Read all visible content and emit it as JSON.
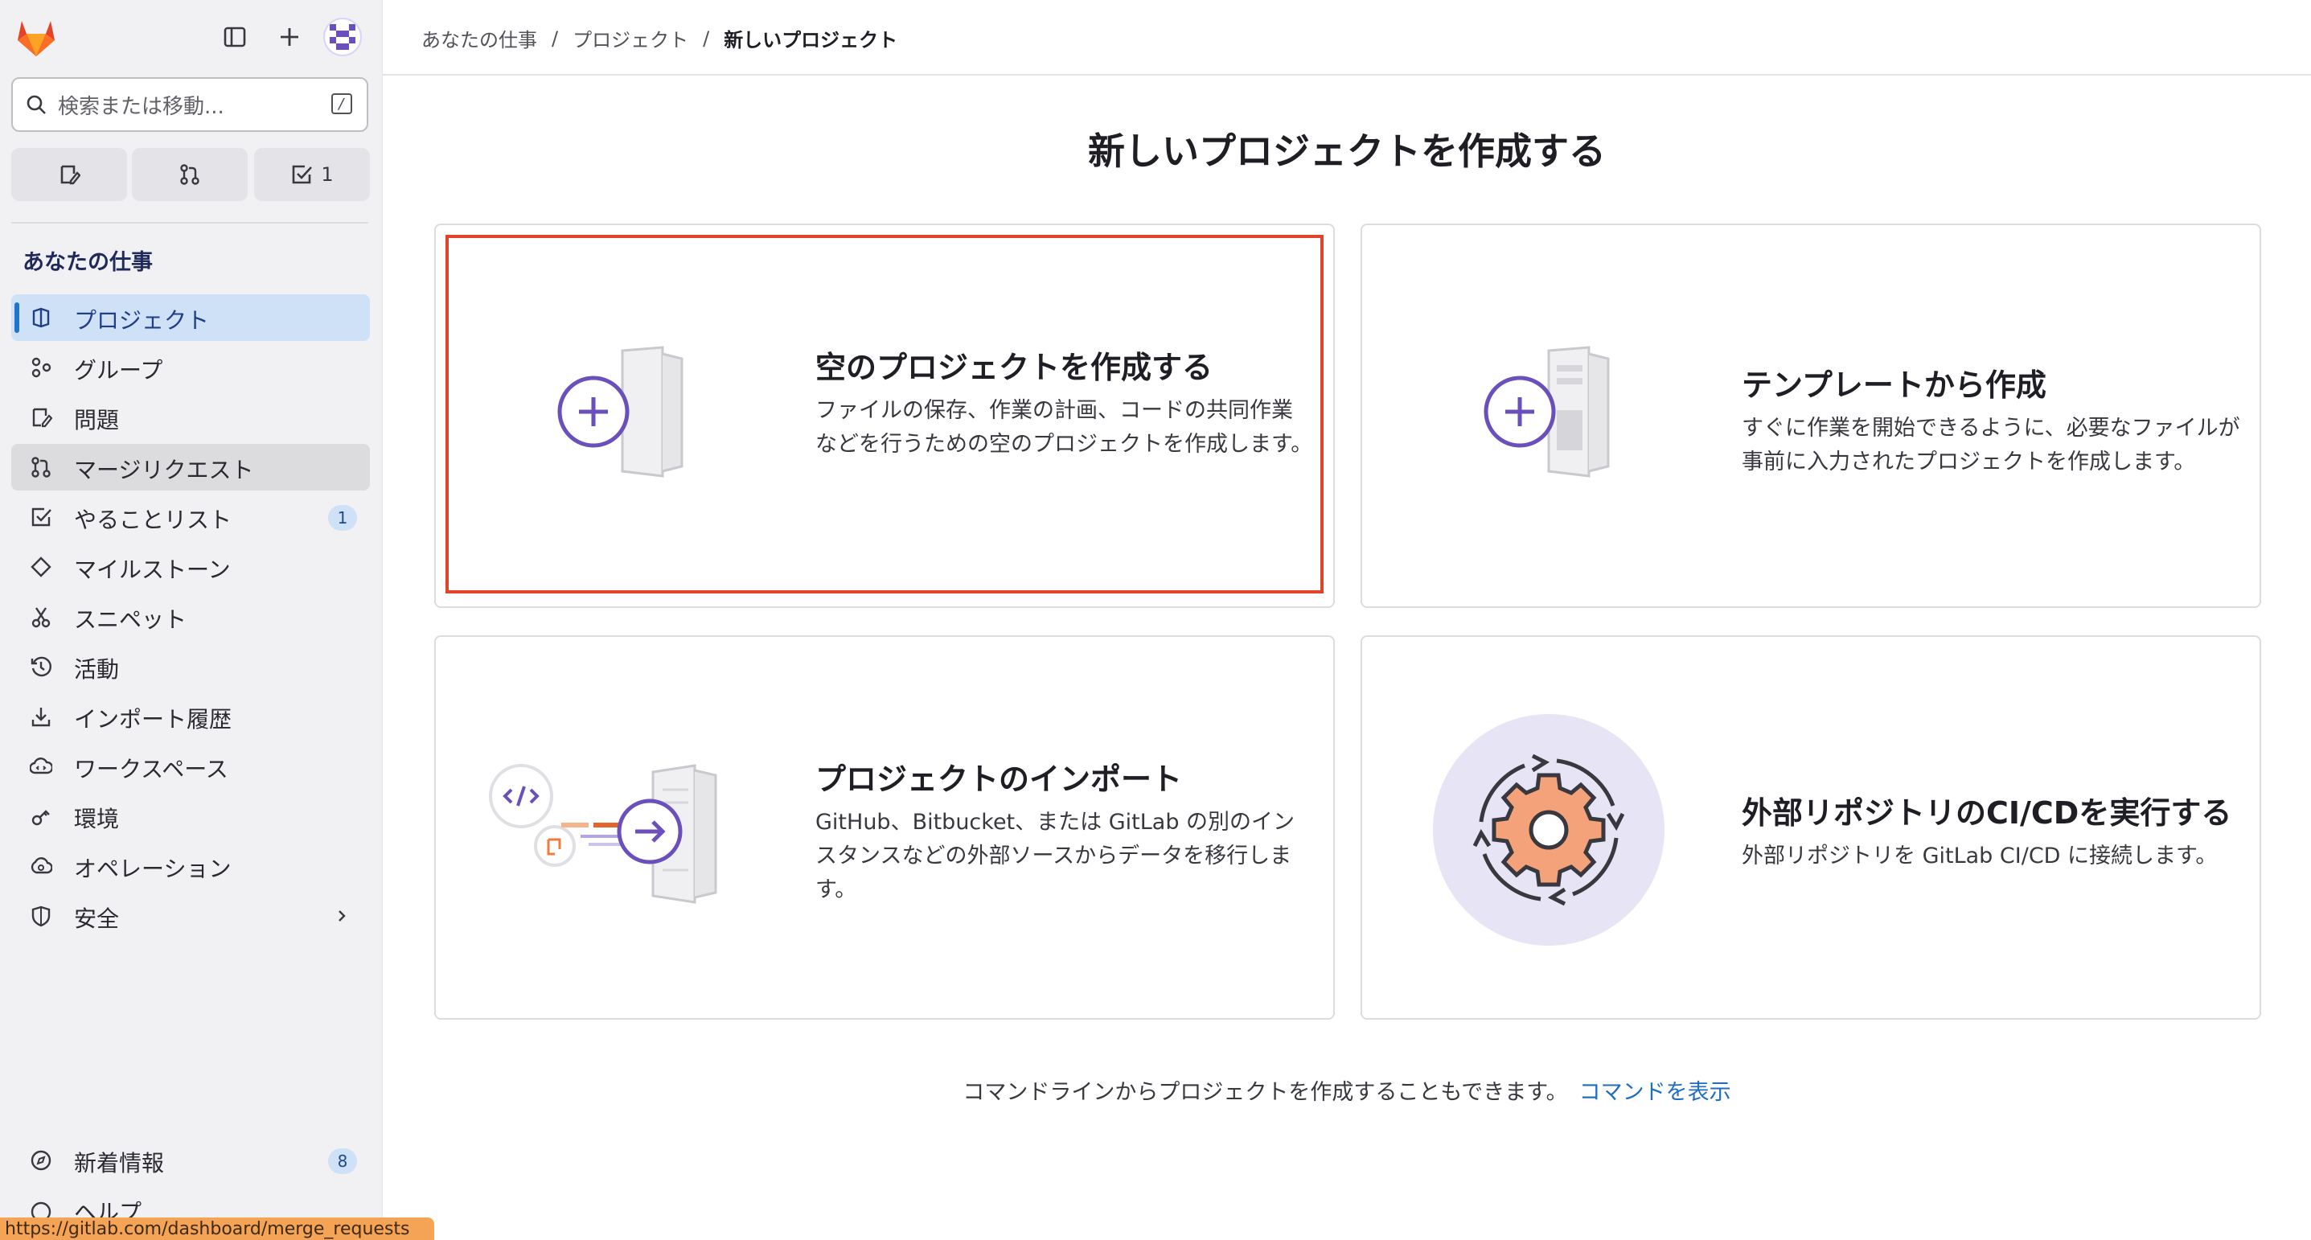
{
  "sidebar": {
    "search_placeholder": "検索または移動...",
    "search_shortcut": "/",
    "quick_actions": {
      "todo_count": "1"
    },
    "section_title": "あなたの仕事",
    "items": [
      {
        "label": "プロジェクト",
        "icon": "project-icon"
      },
      {
        "label": "グループ",
        "icon": "group-icon"
      },
      {
        "label": "問題",
        "icon": "issues-icon"
      },
      {
        "label": "マージリクエスト",
        "icon": "merge-request-icon"
      },
      {
        "label": "やることリスト",
        "icon": "todo-icon",
        "badge": "1"
      },
      {
        "label": "マイルストーン",
        "icon": "milestone-icon"
      },
      {
        "label": "スニペット",
        "icon": "snippet-icon"
      },
      {
        "label": "活動",
        "icon": "history-icon"
      },
      {
        "label": "インポート履歴",
        "icon": "import-icon"
      },
      {
        "label": "ワークスペース",
        "icon": "workspace-icon"
      },
      {
        "label": "環境",
        "icon": "environment-icon"
      },
      {
        "label": "オペレーション",
        "icon": "operations-icon"
      },
      {
        "label": "安全",
        "icon": "security-icon"
      }
    ],
    "whats_new": {
      "label": "新着情報",
      "badge": "8"
    },
    "help_label": "ヘルプ",
    "status_url": "https://gitlab.com/dashboard/merge_requests"
  },
  "breadcrumb": [
    "あなたの仕事",
    "プロジェクト",
    "新しいプロジェクト"
  ],
  "main": {
    "title": "新しいプロジェクトを作成する",
    "cards": [
      {
        "title": "空のプロジェクトを作成する",
        "description": "ファイルの保存、作業の計画、コードの共同作業などを行うための空のプロジェクトを作成します。"
      },
      {
        "title": "テンプレートから作成",
        "description": "すぐに作業を開始できるように、必要なファイルが事前に入力されたプロジェクトを作成します。"
      },
      {
        "title": "プロジェクトのインポート",
        "description": "GitHub、Bitbucket、または GitLab の別のインスタンスなどの外部ソースからデータを移行します。"
      },
      {
        "title": "外部リポジトリのCI/CDを実行する",
        "description": "外部リポジトリを GitLab CI/CD に接続します。"
      }
    ],
    "footer_text": "コマンドラインからプロジェクトを作成することもできます。",
    "footer_link": "コマンドを表示"
  },
  "colors": {
    "accent": "#1f75cb",
    "highlight_border": "#e2432a",
    "illustration_purple": "#6b4fbb"
  }
}
